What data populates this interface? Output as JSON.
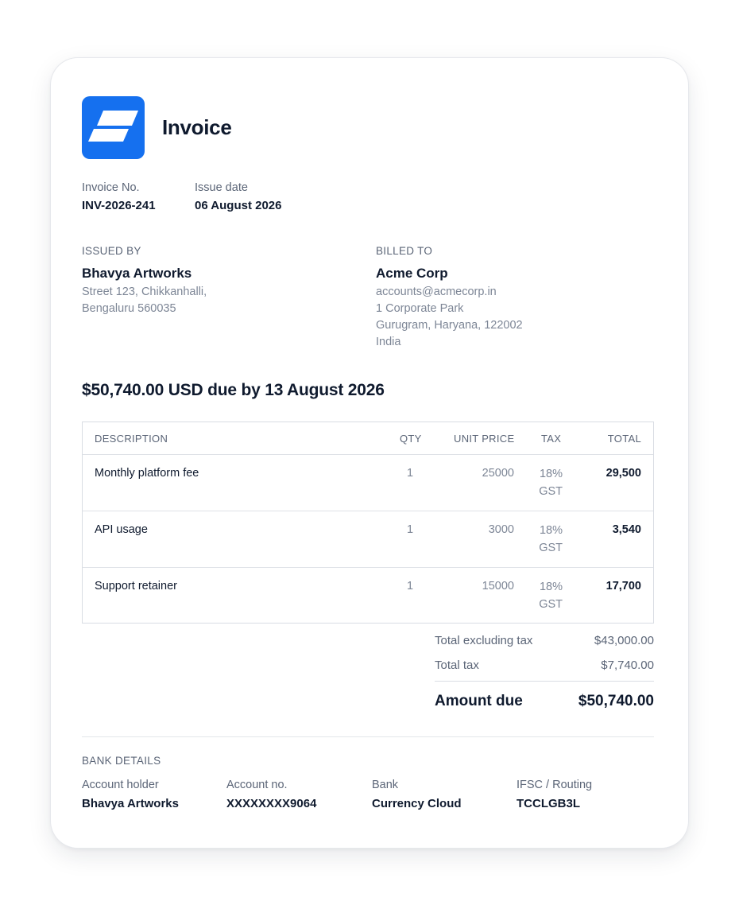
{
  "header": {
    "title": "Invoice",
    "logo_icon": "brand-logo-icon",
    "brand_color": "#1570ef"
  },
  "meta": {
    "invoice_no_label": "Invoice No.",
    "invoice_no": "INV-2026-241",
    "issue_date_label": "Issue date",
    "issue_date": "06 August 2026"
  },
  "issued_by": {
    "label": "ISSUED BY",
    "name": "Bhavya Artworks",
    "address_lines": [
      "Street 123, Chikkanhalli,",
      "Bengaluru 560035"
    ]
  },
  "billed_to": {
    "label": "BILLED TO",
    "name": "Acme Corp",
    "address_lines": [
      "accounts@acmecorp.in",
      "1 Corporate Park",
      "Gurugram, Haryana, 122002",
      "India"
    ]
  },
  "due_heading": "$50,740.00 USD due by 13 August 2026",
  "table": {
    "headers": {
      "description": "DESCRIPTION",
      "qty": "QTY",
      "unit_price": "UNIT PRICE",
      "tax": "TAX",
      "total": "TOTAL"
    },
    "rows": [
      {
        "description": "Monthly platform fee",
        "qty": "1",
        "unit_price": "25000",
        "tax_rate": "18%",
        "tax_type": "GST",
        "total": "29,500"
      },
      {
        "description": "API usage",
        "qty": "1",
        "unit_price": "3000",
        "tax_rate": "18%",
        "tax_type": "GST",
        "total": "3,540"
      },
      {
        "description": "Support retainer",
        "qty": "1",
        "unit_price": "15000",
        "tax_rate": "18%",
        "tax_type": "GST",
        "total": "17,700"
      }
    ]
  },
  "summary": {
    "subtotal_label": "Total excluding tax",
    "subtotal": "$43,000.00",
    "tax_label": "Total tax",
    "tax": "$7,740.00",
    "amount_due_label": "Amount due",
    "amount_due": "$50,740.00"
  },
  "bank": {
    "label": "BANK DETAILS",
    "holder_label": "Account holder",
    "holder": "Bhavya Artworks",
    "account_label": "Account no.",
    "account": "XXXXXXXX9064",
    "bank_label": "Bank",
    "bank": "Currency Cloud",
    "routing_label": "IFSC / Routing",
    "routing": "TCCLGB3L"
  }
}
